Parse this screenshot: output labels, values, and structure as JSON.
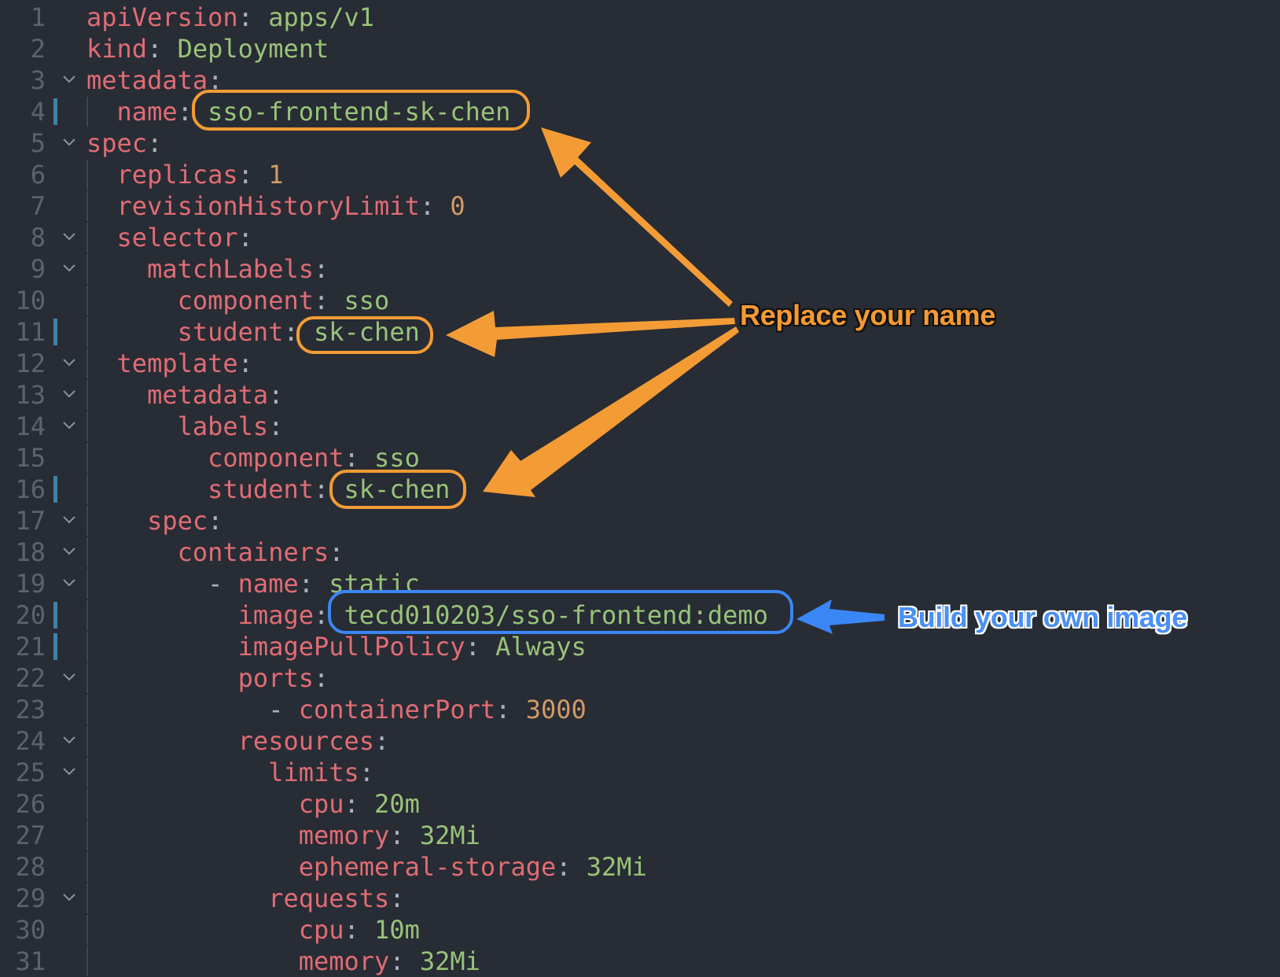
{
  "editor": {
    "language": "yaml",
    "lines": [
      {
        "num": "1",
        "fold": false,
        "modified": false,
        "indent": "",
        "dash": "",
        "key": "apiVersion",
        "sep": ":",
        "value": " apps/v1",
        "vtype": "str"
      },
      {
        "num": "2",
        "fold": false,
        "modified": false,
        "indent": "",
        "dash": "",
        "key": "kind",
        "sep": ":",
        "value": " Deployment",
        "vtype": "str"
      },
      {
        "num": "3",
        "fold": true,
        "modified": false,
        "indent": "",
        "dash": "",
        "key": "metadata",
        "sep": ":",
        "value": "",
        "vtype": "str"
      },
      {
        "num": "4",
        "fold": false,
        "modified": true,
        "indent": "  ",
        "dash": "",
        "key": "name",
        "sep": ":",
        "value": " sso-frontend-sk-chen",
        "vtype": "str"
      },
      {
        "num": "5",
        "fold": true,
        "modified": false,
        "indent": "",
        "dash": "",
        "key": "spec",
        "sep": ":",
        "value": "",
        "vtype": "str"
      },
      {
        "num": "6",
        "fold": false,
        "modified": false,
        "indent": "  ",
        "dash": "",
        "key": "replicas",
        "sep": ":",
        "value": " 1",
        "vtype": "num"
      },
      {
        "num": "7",
        "fold": false,
        "modified": false,
        "indent": "  ",
        "dash": "",
        "key": "revisionHistoryLimit",
        "sep": ":",
        "value": " 0",
        "vtype": "num"
      },
      {
        "num": "8",
        "fold": true,
        "modified": false,
        "indent": "  ",
        "dash": "",
        "key": "selector",
        "sep": ":",
        "value": "",
        "vtype": "str"
      },
      {
        "num": "9",
        "fold": true,
        "modified": false,
        "indent": "    ",
        "dash": "",
        "key": "matchLabels",
        "sep": ":",
        "value": "",
        "vtype": "str"
      },
      {
        "num": "10",
        "fold": false,
        "modified": false,
        "indent": "      ",
        "dash": "",
        "key": "component",
        "sep": ":",
        "value": " sso",
        "vtype": "str"
      },
      {
        "num": "11",
        "fold": false,
        "modified": true,
        "indent": "      ",
        "dash": "",
        "key": "student",
        "sep": ":",
        "value": " sk-chen",
        "vtype": "str"
      },
      {
        "num": "12",
        "fold": true,
        "modified": false,
        "indent": "  ",
        "dash": "",
        "key": "template",
        "sep": ":",
        "value": "",
        "vtype": "str"
      },
      {
        "num": "13",
        "fold": true,
        "modified": false,
        "indent": "    ",
        "dash": "",
        "key": "metadata",
        "sep": ":",
        "value": "",
        "vtype": "str"
      },
      {
        "num": "14",
        "fold": true,
        "modified": false,
        "indent": "      ",
        "dash": "",
        "key": "labels",
        "sep": ":",
        "value": "",
        "vtype": "str"
      },
      {
        "num": "15",
        "fold": false,
        "modified": false,
        "indent": "        ",
        "dash": "",
        "key": "component",
        "sep": ":",
        "value": " sso",
        "vtype": "str"
      },
      {
        "num": "16",
        "fold": false,
        "modified": true,
        "indent": "        ",
        "dash": "",
        "key": "student",
        "sep": ":",
        "value": " sk-chen",
        "vtype": "str"
      },
      {
        "num": "17",
        "fold": true,
        "modified": false,
        "indent": "    ",
        "dash": "",
        "key": "spec",
        "sep": ":",
        "value": "",
        "vtype": "str"
      },
      {
        "num": "18",
        "fold": true,
        "modified": false,
        "indent": "      ",
        "dash": "",
        "key": "containers",
        "sep": ":",
        "value": "",
        "vtype": "str"
      },
      {
        "num": "19",
        "fold": true,
        "modified": false,
        "indent": "        ",
        "dash": "- ",
        "key": "name",
        "sep": ":",
        "value": " static",
        "vtype": "str"
      },
      {
        "num": "20",
        "fold": false,
        "modified": true,
        "indent": "          ",
        "dash": "",
        "key": "image",
        "sep": ":",
        "value": " tecd010203/sso-frontend:demo",
        "vtype": "str"
      },
      {
        "num": "21",
        "fold": false,
        "modified": true,
        "indent": "          ",
        "dash": "",
        "key": "imagePullPolicy",
        "sep": ":",
        "value": " Always",
        "vtype": "str"
      },
      {
        "num": "22",
        "fold": true,
        "modified": false,
        "indent": "          ",
        "dash": "",
        "key": "ports",
        "sep": ":",
        "value": "",
        "vtype": "str"
      },
      {
        "num": "23",
        "fold": false,
        "modified": false,
        "indent": "            ",
        "dash": "- ",
        "key": "containerPort",
        "sep": ":",
        "value": " 3000",
        "vtype": "num"
      },
      {
        "num": "24",
        "fold": true,
        "modified": false,
        "indent": "          ",
        "dash": "",
        "key": "resources",
        "sep": ":",
        "value": "",
        "vtype": "str"
      },
      {
        "num": "25",
        "fold": true,
        "modified": false,
        "indent": "            ",
        "dash": "",
        "key": "limits",
        "sep": ":",
        "value": "",
        "vtype": "str"
      },
      {
        "num": "26",
        "fold": false,
        "modified": false,
        "indent": "              ",
        "dash": "",
        "key": "cpu",
        "sep": ":",
        "value": " 20m",
        "vtype": "str"
      },
      {
        "num": "27",
        "fold": false,
        "modified": false,
        "indent": "              ",
        "dash": "",
        "key": "memory",
        "sep": ":",
        "value": " 32Mi",
        "vtype": "str"
      },
      {
        "num": "28",
        "fold": false,
        "modified": false,
        "indent": "              ",
        "dash": "",
        "key": "ephemeral-storage",
        "sep": ":",
        "value": " 32Mi",
        "vtype": "str"
      },
      {
        "num": "29",
        "fold": true,
        "modified": false,
        "indent": "            ",
        "dash": "",
        "key": "requests",
        "sep": ":",
        "value": "",
        "vtype": "str"
      },
      {
        "num": "30",
        "fold": false,
        "modified": false,
        "indent": "              ",
        "dash": "",
        "key": "cpu",
        "sep": ":",
        "value": " 10m",
        "vtype": "str"
      },
      {
        "num": "31",
        "fold": false,
        "modified": false,
        "indent": "              ",
        "dash": "",
        "key": "memory",
        "sep": ":",
        "value": " 32Mi",
        "vtype": "str"
      }
    ]
  },
  "annotations": {
    "replace_name": {
      "text": "Replace your name",
      "color": "#f39b35"
    },
    "build_image": {
      "text": "Build your own image",
      "color": "#3b86f5"
    }
  },
  "colors": {
    "background": "#282c34",
    "key": "#e06c75",
    "string": "#98c379",
    "number": "#d19a66",
    "line_number": "#5c6370",
    "modified_marker": "#3d82a8"
  }
}
